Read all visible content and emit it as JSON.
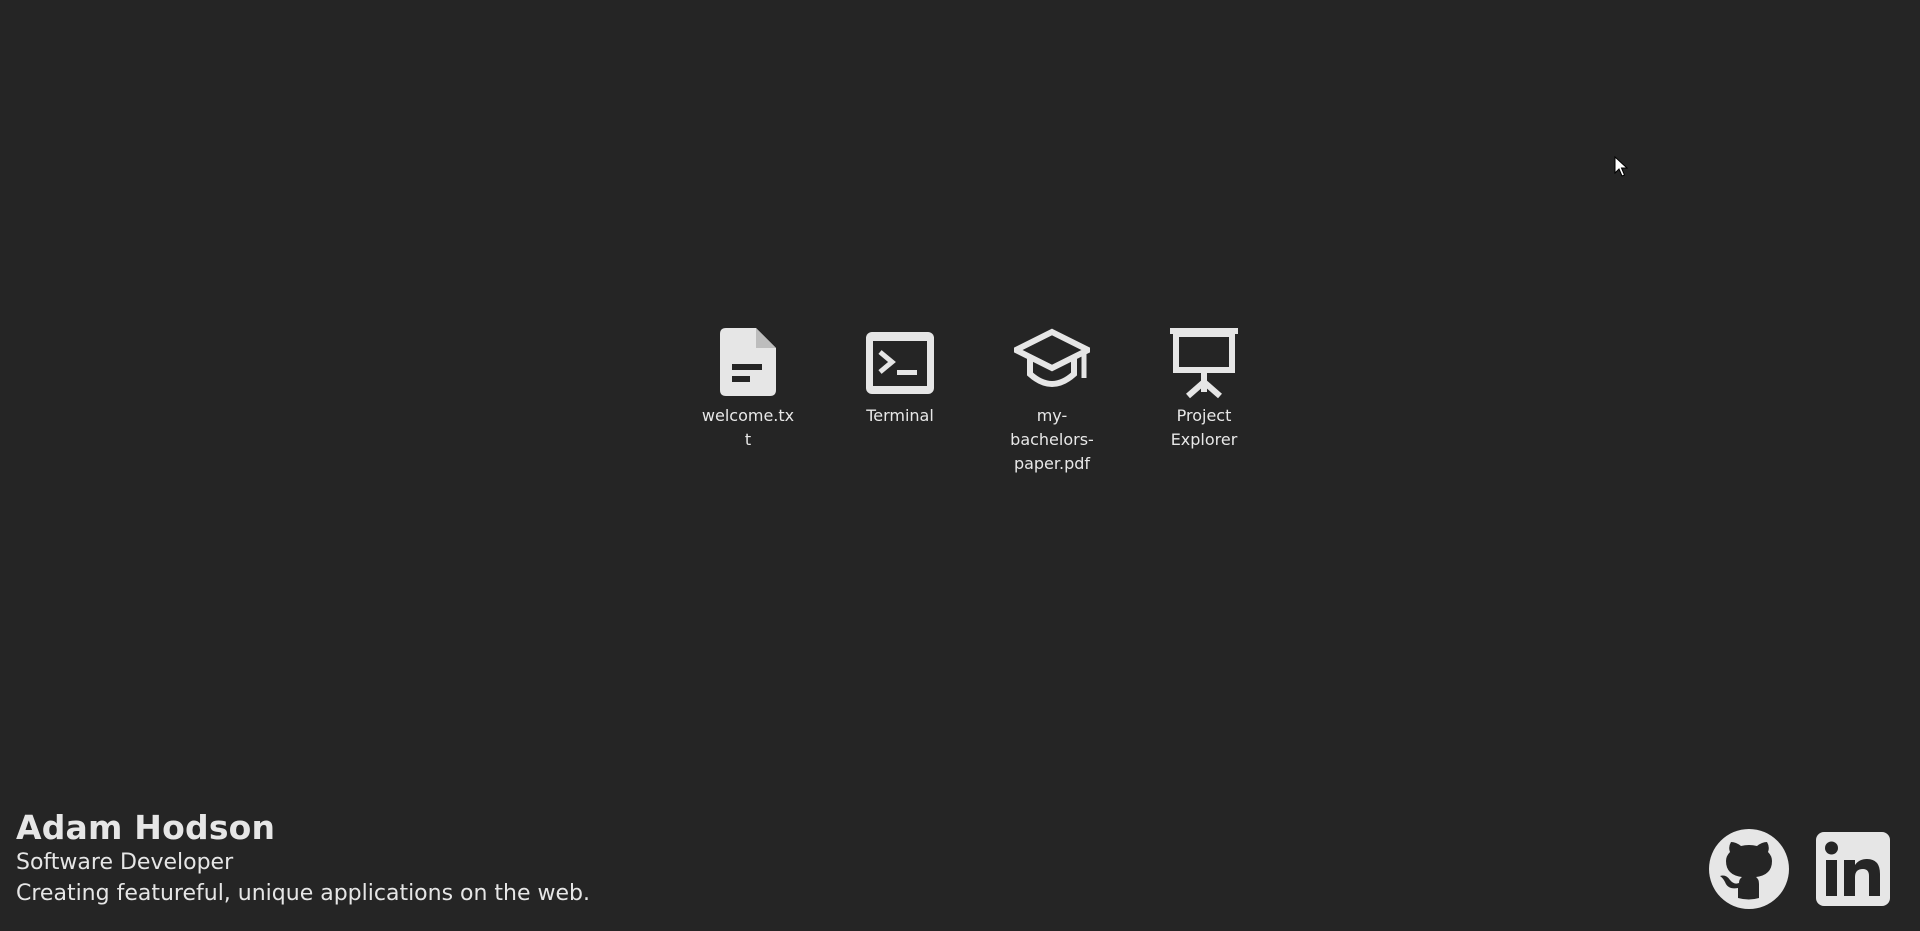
{
  "desktop": {
    "background": "#252525",
    "items": [
      {
        "label": "welcome.txt",
        "icon": "document-icon"
      },
      {
        "label": "Terminal",
        "icon": "terminal-icon"
      },
      {
        "label": "my-bachelors-paper.pdf",
        "icon": "graduation-cap-icon"
      },
      {
        "label": "Project Explorer",
        "icon": "presentation-easel-icon"
      }
    ]
  },
  "profile": {
    "name": "Adam Hodson",
    "role": "Software Developer",
    "tagline": "Creating featureful, unique applications on the web."
  },
  "social": {
    "links": [
      {
        "icon": "github-icon"
      },
      {
        "icon": "linkedin-icon"
      }
    ]
  },
  "colors": {
    "foreground": "#e6e6e6"
  }
}
